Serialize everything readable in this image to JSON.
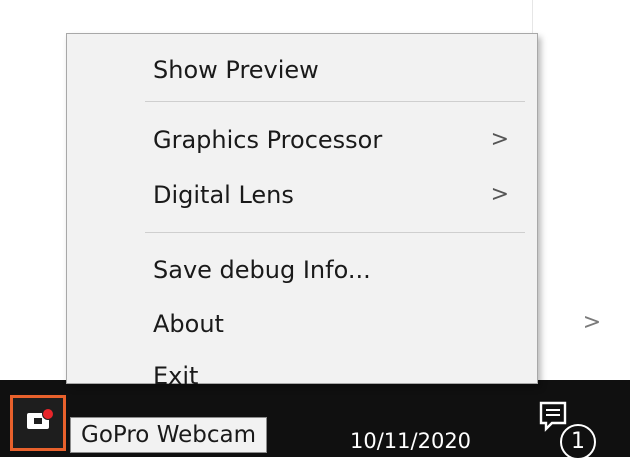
{
  "context_menu": {
    "items": [
      {
        "label": "Show Preview",
        "submenu": false
      },
      {
        "label": "Graphics Processor",
        "submenu": true
      },
      {
        "label": "Digital Lens",
        "submenu": true
      },
      {
        "label": "Save debug Info...",
        "submenu": false
      },
      {
        "label": "About",
        "submenu": false
      },
      {
        "label": "Exit",
        "submenu": false
      }
    ],
    "submenu_arrow": ">"
  },
  "background": {
    "chevron": ">"
  },
  "taskbar": {
    "tray_icon": "gopro-webcam-tray-icon",
    "tooltip": "GoPro Webcam",
    "clock_date": "10/11/2020",
    "notification_icon": "action-center-icon",
    "notification_count": "1"
  },
  "colors": {
    "tray_highlight": "#e8612c",
    "taskbar": "#101010",
    "menu_background": "#f2f2f2"
  }
}
